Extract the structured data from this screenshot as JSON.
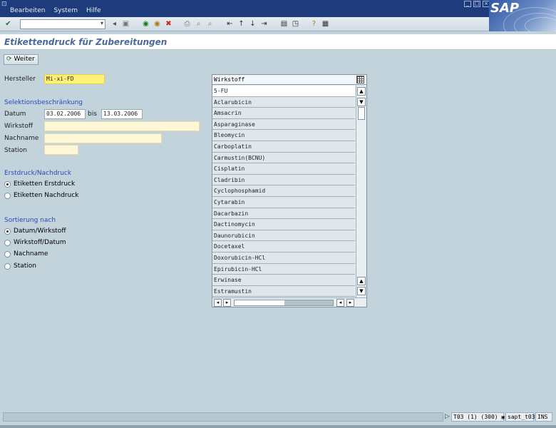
{
  "window": {
    "menu": [
      "Bearbeiten",
      "System",
      "Hilfe"
    ],
    "logo_text": "SAP"
  },
  "toolbar": {
    "command_field_value": "",
    "icons": [
      "check-icon",
      "back-icon",
      "save-icon",
      "green-arrow-icon",
      "exit-icon",
      "cancel-icon",
      "print-icon",
      "find-icon",
      "find-next-icon",
      "first-page-icon",
      "prev-page-icon",
      "next-page-icon",
      "last-page-icon",
      "new-session-icon",
      "shortcut-icon",
      "help-icon",
      "layout-icon"
    ]
  },
  "page": {
    "title": "Etikettendruck für Zubereitungen"
  },
  "app_toolbar": {
    "weiter_label": "Weiter"
  },
  "form": {
    "hersteller_label": "Hersteller",
    "hersteller_value": "Mi-xi-FD",
    "selection_title": "Selektionsbeschränkung",
    "datum_label": "Datum",
    "datum_from": "03.02.2006",
    "bis_label": "bis",
    "datum_to": "13.03.2006",
    "wirkstoff_label": "Wirkstoff",
    "wirkstoff_value": "",
    "nachname_label": "Nachname",
    "nachname_value": "",
    "station_label": "Station",
    "station_value": ""
  },
  "print_mode": {
    "title": "Erstdruck/Nachdruck",
    "options": [
      {
        "label": "Etiketten Erstdruck",
        "selected": true
      },
      {
        "label": "Etiketten Nachdruck",
        "selected": false
      }
    ]
  },
  "sort": {
    "title": "Sortierung nach",
    "options": [
      {
        "label": "Datum/Wirkstoff",
        "selected": true
      },
      {
        "label": "Wirkstoff/Datum",
        "selected": false
      },
      {
        "label": "Nachname",
        "selected": false
      },
      {
        "label": "Station",
        "selected": false
      }
    ]
  },
  "dropdown": {
    "header": "Wirkstoff",
    "items": [
      "5-FU",
      "Aclarubicin",
      "Amsacrin",
      "Asparaginase",
      "Bleomycin",
      "Carboplatin",
      "Carmustin(BCNU)",
      "Cisplatin",
      "Cladribin",
      "Cyclophosphamid",
      "Cytarabin",
      "Dacarbazin",
      "Dactinomycin",
      "Daunorubicin",
      "Docetaxel",
      "Doxorubicin-HCl",
      "Epirubicin-HCl",
      "Erwinase",
      "Estramustin"
    ]
  },
  "status_bar": {
    "system": "T03 (1) (300)",
    "server": "sapt_t03",
    "mode": "INS"
  }
}
